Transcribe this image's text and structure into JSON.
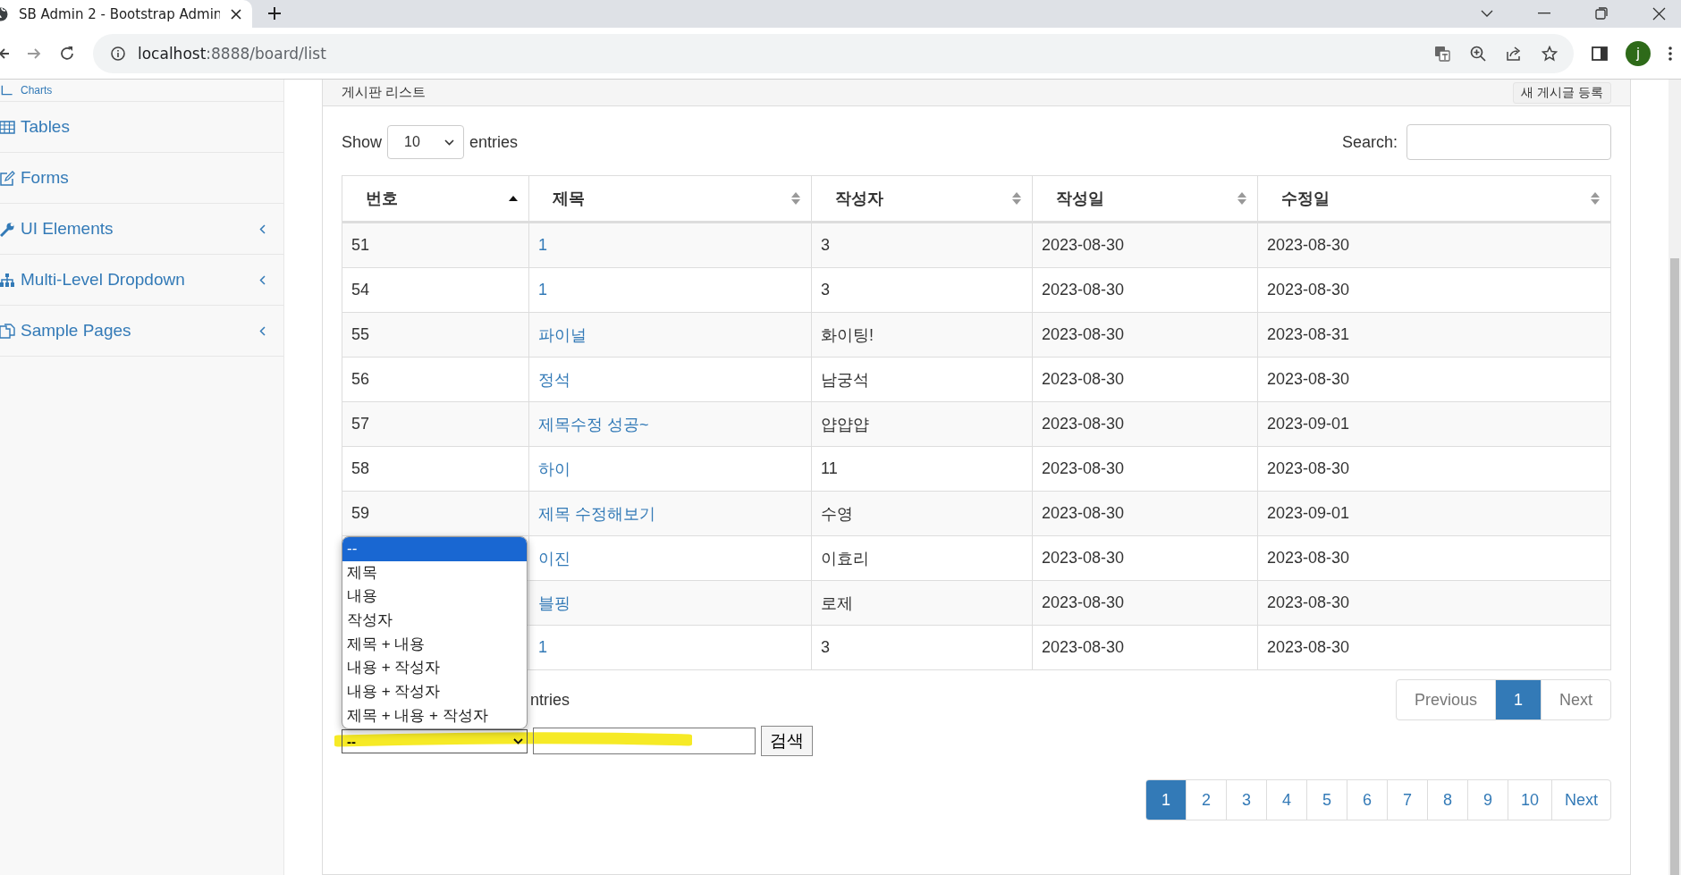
{
  "browser": {
    "tab_title": "SB Admin 2 - Bootstrap Admin",
    "url_host": "localhost",
    "url_path": ":8888/board/list",
    "avatar": "j"
  },
  "sidebar": {
    "items": [
      {
        "label": "Charts",
        "kind": "chart",
        "has_submenu": false
      },
      {
        "label": "Tables",
        "kind": "table",
        "has_submenu": false
      },
      {
        "label": "Forms",
        "kind": "edit",
        "has_submenu": false
      },
      {
        "label": "UI Elements",
        "kind": "wrench",
        "has_submenu": true
      },
      {
        "label": "Multi-Level Dropdown",
        "kind": "sitemap",
        "has_submenu": true
      },
      {
        "label": "Sample Pages",
        "kind": "files",
        "has_submenu": true
      }
    ]
  },
  "panel": {
    "title": "게시판 리스트",
    "new_post_button": "새 게시글 등록"
  },
  "length_menu": {
    "show_label": "Show",
    "value": "10",
    "entries_label": "entries"
  },
  "search": {
    "label": "Search:"
  },
  "table": {
    "columns": [
      {
        "label": "번호",
        "sorted": true
      },
      {
        "label": "제목",
        "sorted": false
      },
      {
        "label": "작성자",
        "sorted": false
      },
      {
        "label": "작성일",
        "sorted": false
      },
      {
        "label": "수정일",
        "sorted": false
      }
    ],
    "rows": [
      {
        "number": "51",
        "title": "1",
        "writer": "3",
        "created": "2023-08-30",
        "updated": "2023-08-30"
      },
      {
        "number": "54",
        "title": "1",
        "writer": "3",
        "created": "2023-08-30",
        "updated": "2023-08-30"
      },
      {
        "number": "55",
        "title": "파이널",
        "writer": "화이팅!",
        "created": "2023-08-30",
        "updated": "2023-08-31"
      },
      {
        "number": "56",
        "title": "정석",
        "writer": "남궁석",
        "created": "2023-08-30",
        "updated": "2023-08-30"
      },
      {
        "number": "57",
        "title": "제목수정 성공~",
        "writer": "얍얍얍",
        "created": "2023-08-30",
        "updated": "2023-09-01"
      },
      {
        "number": "58",
        "title": "하이",
        "writer": "11",
        "created": "2023-08-30",
        "updated": "2023-08-30"
      },
      {
        "number": "59",
        "title": "제목 수정해보기",
        "writer": "수영",
        "created": "2023-08-30",
        "updated": "2023-09-01"
      },
      {
        "title": "이진",
        "writer": "이효리",
        "created": "2023-08-30",
        "updated": "2023-08-30"
      },
      {
        "title": "블핑",
        "writer": "로제",
        "created": "2023-08-30",
        "updated": "2023-08-30"
      },
      {
        "title": "1",
        "writer": "3",
        "created": "2023-08-30",
        "updated": "2023-08-30"
      }
    ]
  },
  "info_text": "ntries",
  "table_pagination": [
    {
      "label": "Previous",
      "selected": false,
      "disabled": true
    },
    {
      "label": "1",
      "selected": true,
      "disabled": false
    },
    {
      "label": "Next",
      "selected": false,
      "disabled": true
    }
  ],
  "search_form": {
    "select_value": "--",
    "options": [
      {
        "label": "--",
        "selected": true
      },
      {
        "label": "제목",
        "selected": false
      },
      {
        "label": "내용",
        "selected": false
      },
      {
        "label": "작성자",
        "selected": false
      },
      {
        "label": "제목 + 내용",
        "selected": false
      },
      {
        "label": "내용 + 작성자",
        "selected": false
      },
      {
        "label": "내용 + 작성자",
        "selected": false
      },
      {
        "label": "제목 + 내용 + 작성자",
        "selected": false
      }
    ],
    "button": "검색"
  },
  "page_links": [
    {
      "label": "1",
      "selected": true
    },
    {
      "label": "2",
      "selected": false
    },
    {
      "label": "3",
      "selected": false
    },
    {
      "label": "4",
      "selected": false
    },
    {
      "label": "5",
      "selected": false
    },
    {
      "label": "6",
      "selected": false
    },
    {
      "label": "7",
      "selected": false
    },
    {
      "label": "8",
      "selected": false
    },
    {
      "label": "9",
      "selected": false
    },
    {
      "label": "10",
      "selected": false
    },
    {
      "label": "Next",
      "selected": false
    }
  ]
}
